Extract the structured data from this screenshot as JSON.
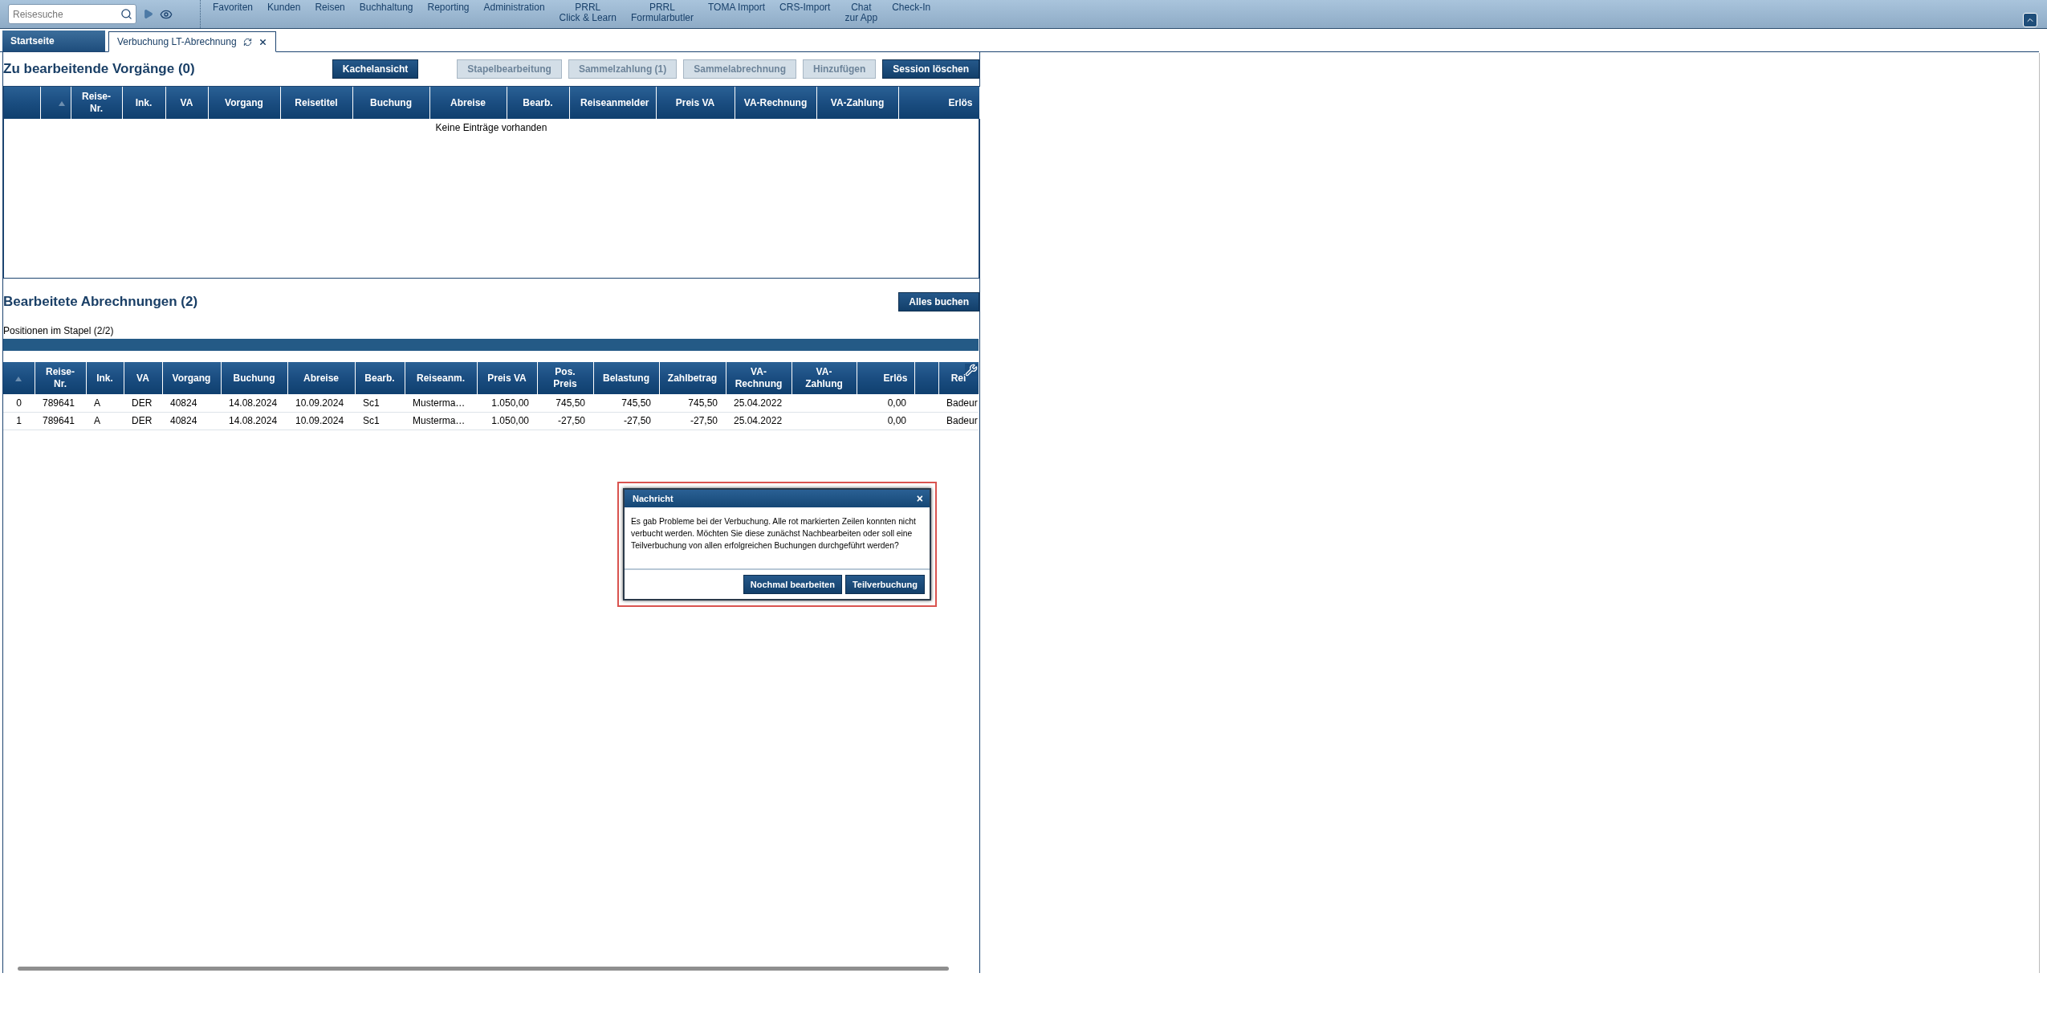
{
  "toolbar": {
    "search": {
      "placeholder": "Reisesuche"
    },
    "nav_items": [
      "Favoriten",
      "Kunden",
      "Reisen",
      "Buchhaltung",
      "Reporting",
      "Administration",
      "PRRL\nClick & Learn",
      "PRRL\nFormularbutler",
      "TOMA Import",
      "CRS-Import",
      "Chat\nzur App",
      "Check-In"
    ]
  },
  "tabs": [
    {
      "label": "Startseite",
      "selected": false,
      "closable": false
    },
    {
      "label": "Verbuchung LT-Abrechnung",
      "selected": true,
      "closable": true
    }
  ],
  "open_section": {
    "title": "Zu bearbeitende Vorgänge (0)",
    "buttons": [
      {
        "label": "Kachelansicht",
        "disabled": false
      },
      {
        "label": "Stapelbearbeitung",
        "disabled": true
      },
      {
        "label": "Sammelzahlung (1)",
        "disabled": true
      },
      {
        "label": "Sammelabrechnung",
        "disabled": true
      },
      {
        "label": "Hinzufügen",
        "disabled": true
      },
      {
        "label": "Session löschen",
        "disabled": false
      }
    ],
    "columns": [
      {},
      {
        "sorted": true
      },
      {
        "label": "Reise-\nNr."
      },
      {
        "label": "Ink."
      },
      {
        "label": "VA"
      },
      {
        "label": "Vorgang"
      },
      {
        "label": "Reisetitel"
      },
      {
        "label": "Buchung"
      },
      {
        "label": "Abreise"
      },
      {
        "label": "Bearb."
      },
      {
        "label": "Reiseanmelder"
      },
      {
        "label": "Preis VA"
      },
      {
        "label": "VA-Rechnung"
      },
      {
        "label": "VA-Zahlung"
      },
      {
        "label": "Erlös"
      }
    ],
    "empty_text": "Keine Einträge vorhanden"
  },
  "done_section": {
    "title": "Bearbeitete Abrechnungen (2)",
    "button": "Alles buchen",
    "progress_label": "Positionen im Stapel (2/2)",
    "progress": {
      "level": 1
    },
    "columns": [
      {
        "sorted": true
      },
      {
        "label": "Reise-\nNr."
      },
      {
        "label": "Ink."
      },
      {
        "label": "VA"
      },
      {
        "label": "Vorgang"
      },
      {
        "label": "Buchung"
      },
      {
        "label": "Abreise"
      },
      {
        "label": "Bearb."
      },
      {
        "label": "Reiseanm."
      },
      {
        "label": "Preis VA"
      },
      {
        "label": "Pos.\nPreis"
      },
      {
        "label": "Belastung"
      },
      {
        "label": "Zahlbetrag"
      },
      {
        "label": "VA-\nRechnung"
      },
      {
        "label": "VA-\nZahlung"
      },
      {
        "label": "Erlös"
      },
      {},
      {
        "label": "Rei"
      }
    ],
    "rows": [
      [
        "0",
        "789641",
        "A",
        "DER",
        "40824",
        "14.08.2024",
        "10.09.2024",
        "Sc1",
        "Musterma…",
        "1.050,00",
        "745,50",
        "745,50",
        "745,50",
        "25.04.2022",
        null,
        "0,00",
        null,
        "Badeur"
      ],
      [
        "1",
        "789641",
        "A",
        "DER",
        "40824",
        "14.08.2024",
        "10.09.2024",
        "Sc1",
        "Musterma…",
        "1.050,00",
        "-27,50",
        "-27,50",
        "-27,50",
        "25.04.2022",
        null,
        "0,00",
        null,
        "Badeur"
      ]
    ]
  },
  "dialog": {
    "title": "Nachricht",
    "close": "×",
    "message": "Es gab Probleme bei der Verbuchung. Alle rot markierten Zeilen konnten nicht verbucht werden. Möchten Sie diese zunächst Nachbearbeiten oder soll eine Teilverbuchung von allen erfolgreichen Buchungen durchgeführt werden?",
    "buttons": [
      "Nochmal bearbeiten",
      "Teilverbuchung"
    ]
  }
}
